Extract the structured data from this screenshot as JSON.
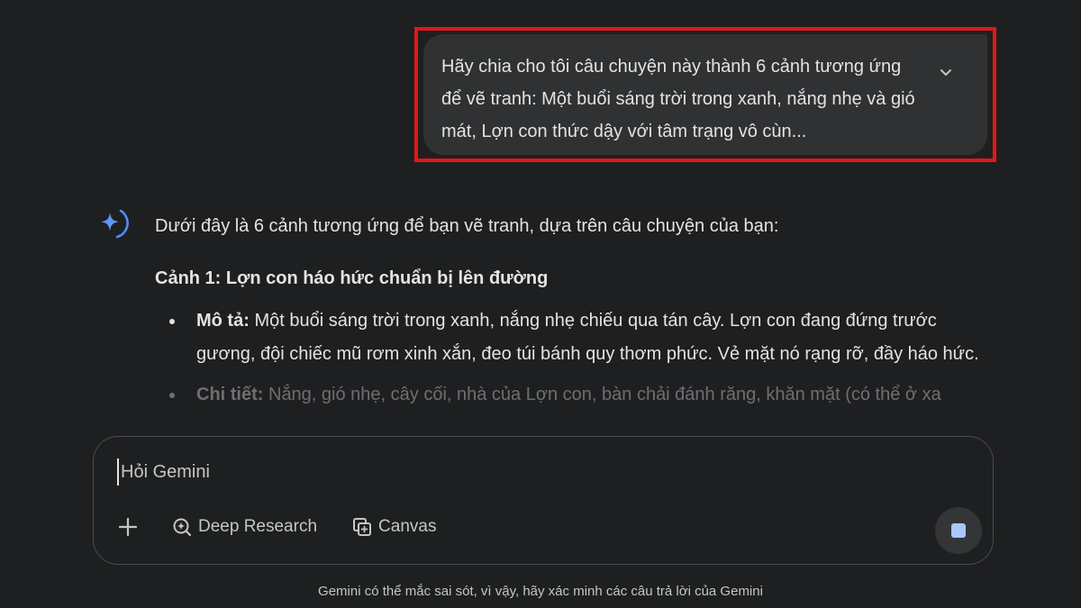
{
  "user_prompt": {
    "text": "Hãy chia cho tôi câu chuyện này thành 6 cảnh tương ứng để vẽ tranh: Một buổi sáng trời trong xanh, nắng nhẹ và gió mát, Lợn con thức dậy với tâm trạng vô cùn...",
    "expand_icon": "chevron-down-icon"
  },
  "response": {
    "intro": "Dưới đây là 6 cảnh tương ứng để bạn vẽ tranh, dựa trên câu chuyện của bạn:",
    "scene_title": "Cảnh 1: Lợn con háo hức chuẩn bị lên đường",
    "bullets": [
      {
        "label": "Mô tả:",
        "text": " Một buổi sáng trời trong xanh, nắng nhẹ chiếu qua tán cây. Lợn con đang đứng trước gương, đội chiếc mũ rơm xinh xắn, đeo túi bánh quy thơm phức. Vẻ mặt nó rạng rỡ, đầy háo hức."
      },
      {
        "label": "Chi tiết:",
        "text": " Nắng, gió nhẹ, cây cối, nhà của Lợn con, bàn chải đánh răng, khăn mặt (có thể ở xa"
      }
    ]
  },
  "composer": {
    "placeholder": "Hỏi Gemini",
    "value": "",
    "deep_research_label": "Deep Research",
    "canvas_label": "Canvas"
  },
  "disclaimer": "Gemini có thể mắc sai sót, vì vậy, hãy xác minh các câu trả lời của Gemini",
  "colors": {
    "background": "#1e1f20",
    "bubble": "#2f3133",
    "highlight_border": "#e21818",
    "accent_blue": "#a8c7fa"
  }
}
